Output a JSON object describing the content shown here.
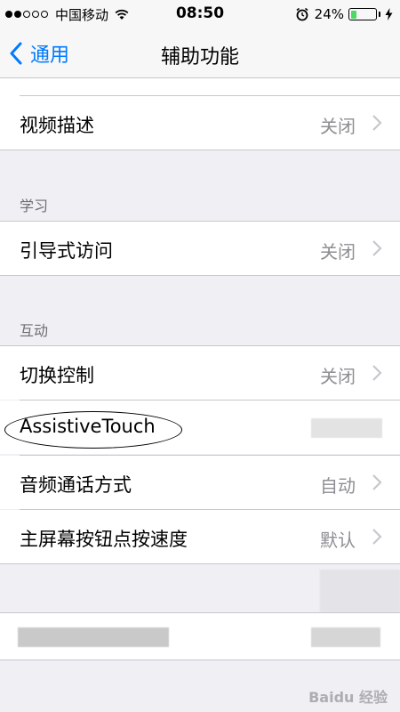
{
  "status_bar": {
    "carrier": "中国移动",
    "time": "08:50",
    "battery_percent": "24%",
    "battery_level": 0.24,
    "icons": [
      "signal-dots",
      "wifi-icon",
      "alarm-icon",
      "battery-icon",
      "charging-bolt-icon"
    ]
  },
  "nav": {
    "back_label": "通用",
    "title": "辅助功能"
  },
  "sections": {
    "video": {
      "rows": [
        {
          "label": "视频描述",
          "value": "关闭"
        }
      ]
    },
    "learning": {
      "header": "学习",
      "rows": [
        {
          "label": "引导式访问",
          "value": "关闭"
        }
      ]
    },
    "interaction": {
      "header": "互动",
      "rows": [
        {
          "label": "切换控制",
          "value": "关闭"
        },
        {
          "label": "AssistiveTouch",
          "value": ""
        },
        {
          "label": "音频通话方式",
          "value": "自动"
        },
        {
          "label": "主屏幕按钮点按速度",
          "value": "默认"
        }
      ]
    }
  },
  "watermark": "Baidu 经验",
  "colors": {
    "accent": "#007aff",
    "background": "#efeff4",
    "secondary_text": "#8e8e93",
    "battery": "#4cd964"
  }
}
